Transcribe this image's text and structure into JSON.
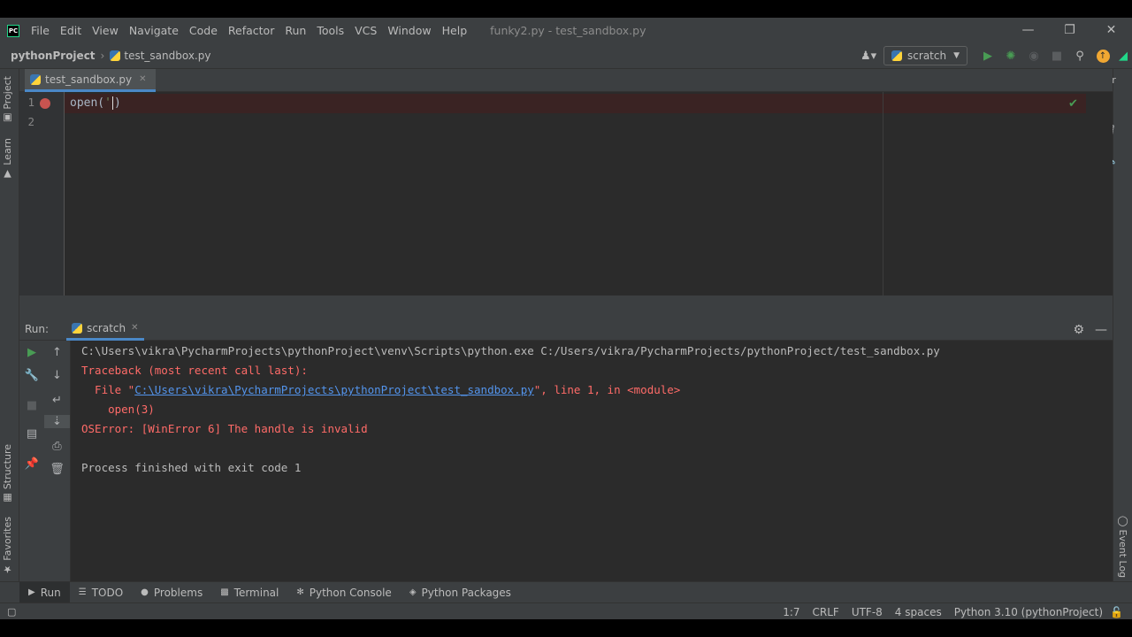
{
  "menu": [
    "File",
    "Edit",
    "View",
    "Navigate",
    "Code",
    "Refactor",
    "Run",
    "Tools",
    "VCS",
    "Window",
    "Help"
  ],
  "window_title": "funky2.py - test_sandbox.py",
  "breadcrumb": {
    "project": "pythonProject",
    "file": "test_sandbox.py"
  },
  "run_config": {
    "name": "scratch"
  },
  "left_tools": {
    "project": "Project",
    "learn": "Learn",
    "structure": "Structure",
    "favorites": "Favorites"
  },
  "right_tools": {
    "event_log_top": "Ever",
    "event_log": "Event Log"
  },
  "editor": {
    "tab": "test_sandbox.py",
    "lines": [
      "1",
      "2"
    ],
    "code_prefix": "open(",
    "code_str": "'",
    "code_suffix": ")"
  },
  "run_panel": {
    "title": "Run:",
    "tab": "scratch",
    "output": {
      "command": "C:\\Users\\vikra\\PycharmProjects\\pythonProject\\venv\\Scripts\\python.exe C:/Users/vikra/PycharmProjects/pythonProject/test_sandbox.py",
      "traceback": "Traceback (most recent call last):",
      "file_prefix": "  File \"",
      "file_link": "C:\\Users\\vikra\\PycharmProjects\\pythonProject\\test_sandbox.py",
      "file_suffix": "\", line 1, in <module>",
      "code": "    open(3)",
      "error": "OSError: [WinError 6] The handle is invalid",
      "exit": "Process finished with exit code 1"
    }
  },
  "bottom_tabs": [
    "Run",
    "TODO",
    "Problems",
    "Terminal",
    "Python Console",
    "Python Packages"
  ],
  "status": {
    "position": "1:7",
    "line_sep": "CRLF",
    "encoding": "UTF-8",
    "indent": "4 spaces",
    "interpreter": "Python 3.10 (pythonProject)"
  },
  "colors": {
    "accent": "#4a88c7",
    "error": "#ff6b68",
    "link": "#5394ec",
    "run_green": "#499c54",
    "breakpoint": "#c75450"
  }
}
